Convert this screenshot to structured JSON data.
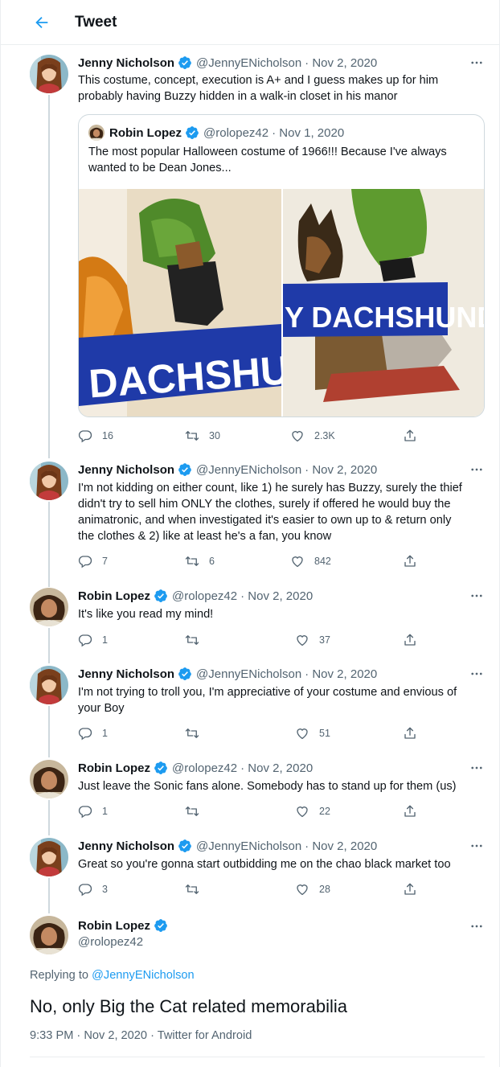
{
  "header": {
    "title": "Tweet"
  },
  "tweets": [
    {
      "name": "Jenny Nicholson",
      "handle": "@JennyENicholson",
      "date": "· Nov 2, 2020",
      "lines": [
        "This costume, concept, execution is A+ and I guess makes up for him",
        "probably having Buzzy hidden in a walk-in closet in his manor"
      ],
      "replies": "16",
      "retweets": "30",
      "likes": "2.3K"
    },
    {
      "name": "Jenny Nicholson",
      "handle": "@JennyENicholson",
      "date": "· Nov 2, 2020",
      "lines": [
        "I'm not kidding on either count, like 1) he surely has Buzzy, surely the thief",
        "didn't try to sell him ONLY the clothes, surely if offered he would buy the",
        "animatronic, and when investigated it's easier to own up to & return only",
        "the clothes & 2) like at least he's a fan, you know"
      ],
      "replies": "7",
      "retweets": "6",
      "likes": "842"
    },
    {
      "name": "Robin Lopez",
      "handle": "@rolopez42",
      "date": "· Nov 2, 2020",
      "lines": [
        "It's like you read my mind!"
      ],
      "replies": "1",
      "retweets": "",
      "likes": "37"
    },
    {
      "name": "Jenny Nicholson",
      "handle": "@JennyENicholson",
      "date": "· Nov 2, 2020",
      "lines": [
        "I'm not trying to troll you, I'm appreciative of your costume and envious of",
        "your Boy"
      ],
      "replies": "1",
      "retweets": "",
      "likes": "51"
    },
    {
      "name": "Robin Lopez",
      "handle": "@rolopez42",
      "date": "· Nov 2, 2020",
      "lines": [
        "Just leave the Sonic fans alone. Somebody has to stand up for them (us)"
      ],
      "replies": "1",
      "retweets": "",
      "likes": "22"
    },
    {
      "name": "Jenny Nicholson",
      "handle": "@JennyENicholson",
      "date": "· Nov 2, 2020",
      "lines": [
        "Great so you're gonna start outbidding me on the chao black market too"
      ],
      "replies": "3",
      "retweets": "",
      "likes": "28"
    }
  ],
  "quote": {
    "name": "Robin Lopez",
    "handle": "@rolopez42",
    "date": "· Nov 1, 2020",
    "lines": [
      "The most popular Halloween costume of 1966!!! Because I've always",
      "wanted to be Dean Jones..."
    ],
    "image_left_text": "DACHSHUN",
    "image_right_text": "Y DACHSHUND"
  },
  "focus": {
    "name": "Robin Lopez",
    "handle": "@rolopez42",
    "replying_prefix": "Replying to ",
    "replying_to": "@JennyENicholson",
    "text": "No, only Big the Cat related memorabilia",
    "meta": "9:33 PM · Nov 2, 2020 · Twitter for Android"
  },
  "colors": {
    "accent": "#1d9bf0",
    "text": "#0f1419",
    "secondary": "#536471",
    "border": "#ebeef0"
  }
}
